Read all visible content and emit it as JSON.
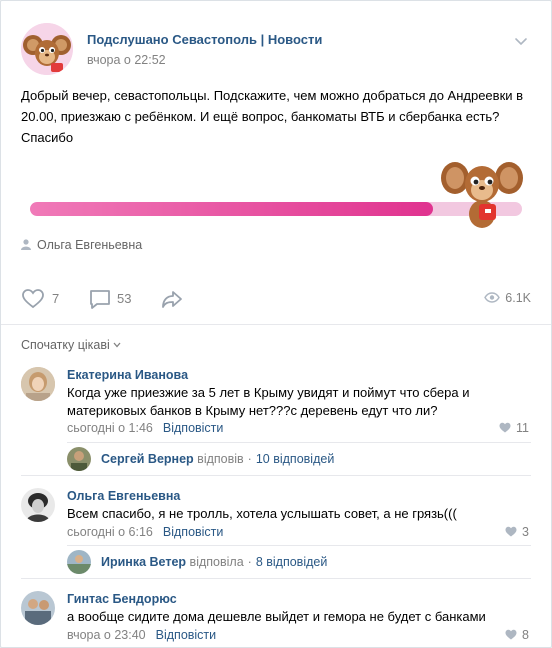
{
  "post": {
    "source_name": "Подслушано Севастополь | Новости",
    "time": "вчора о 22:52",
    "text": "Добрый вечер, севастопольцы. Подскажите, чем можно добраться до Андреевки в 20.00, приезжаю с ребёнком. И ещё вопрос, банкоматы ВТБ и сбербанка есть? Спасибо",
    "progress_fraction": 0.82,
    "author": "Ольга Евгеньевна",
    "likes": "7",
    "comments": "53",
    "views": "6.1K"
  },
  "sort_label": "Спочатку цікаві",
  "comments": [
    {
      "name": "Екатерина Иванова",
      "text": "Когда уже приезжие за 5 лет в Крыму увидят и поймут что сбера и материковых банков в Крыму нет???с деревень едут что ли?",
      "time": "сьогодні о 1:46",
      "reply_link": "Відповісти",
      "likes": "11",
      "reply": {
        "name": "Сергей Вернер",
        "verb": "відповів",
        "count": "10 відповідей"
      }
    },
    {
      "name": "Ольга Евгеньевна",
      "text": "Всем спасибо, я не тролль, хотела услышать совет, а не грязь(((",
      "time": "сьогодні о 6:16",
      "reply_link": "Відповісти",
      "likes": "3",
      "reply": {
        "name": "Иринка Ветер",
        "verb": "відповіла",
        "count": "8 відповідей"
      }
    },
    {
      "name": "Гинтас Бендорюс",
      "text": "а вообще сидите дома дешевле выйдет и гемора не будет с банками",
      "time": "вчора о 23:40",
      "reply_link": "Відповісти",
      "likes": "8"
    }
  ],
  "colors": {
    "link": "#2a5885",
    "muted": "#828282",
    "progress": "#e0338f",
    "track": "#f2c8e0"
  },
  "icons": [
    "chevron-down-icon",
    "user-icon",
    "heart-icon",
    "comment-icon",
    "share-icon",
    "eye-icon"
  ]
}
